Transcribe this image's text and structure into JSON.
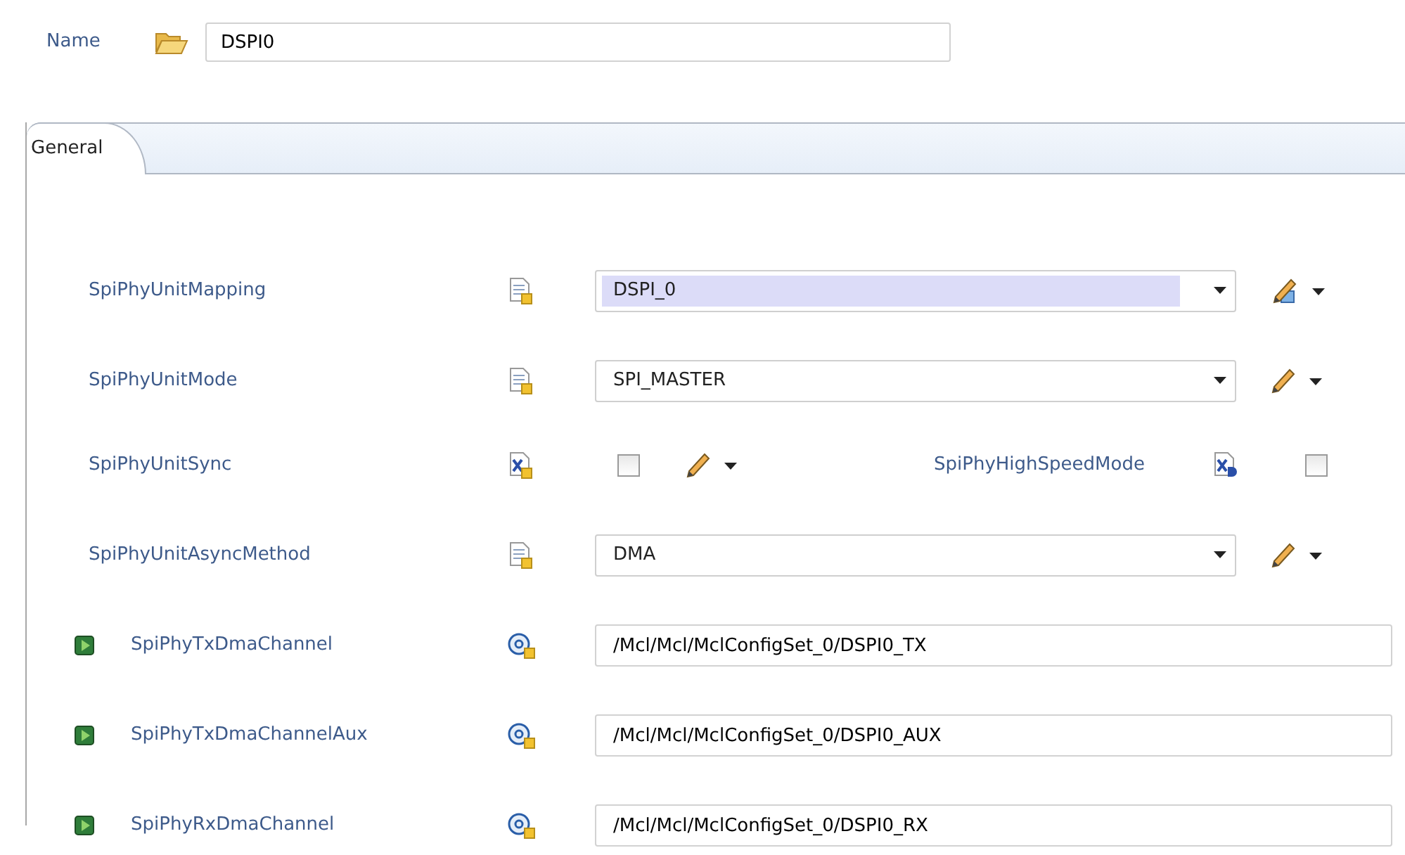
{
  "name_field": {
    "label": "Name",
    "value": "DSPI0"
  },
  "tabs": [
    {
      "label": "General",
      "selected": true
    }
  ],
  "rows": [
    {
      "kind": "combo",
      "label": "SpiPhyUnitMapping",
      "value": "DSPI_0",
      "highlighted": true,
      "action": {
        "kind": "derived"
      }
    },
    {
      "kind": "combo",
      "label": "SpiPhyUnitMode",
      "value": "SPI_MASTER",
      "highlighted": false,
      "action": {
        "kind": "edit"
      }
    },
    {
      "kind": "checkbox",
      "label": "SpiPhyUnitSync",
      "checked": false,
      "action": {
        "kind": "edit"
      },
      "extra": {
        "label": "SpiPhyHighSpeedMode",
        "checked": false
      }
    },
    {
      "kind": "combo",
      "label": "SpiPhyUnitAsyncMethod",
      "value": "DMA",
      "highlighted": false,
      "action": {
        "kind": "edit"
      }
    },
    {
      "kind": "reference",
      "label": "SpiPhyTxDmaChannel",
      "value": "/Mcl/Mcl/MclConfigSet_0/DSPI0_TX"
    },
    {
      "kind": "reference",
      "label": "SpiPhyTxDmaChannelAux",
      "value": "/Mcl/Mcl/MclConfigSet_0/DSPI0_AUX"
    },
    {
      "kind": "reference",
      "label": "SpiPhyRxDmaChannel",
      "value": "/Mcl/Mcl/MclConfigSet_0/DSPI0_RX"
    }
  ]
}
